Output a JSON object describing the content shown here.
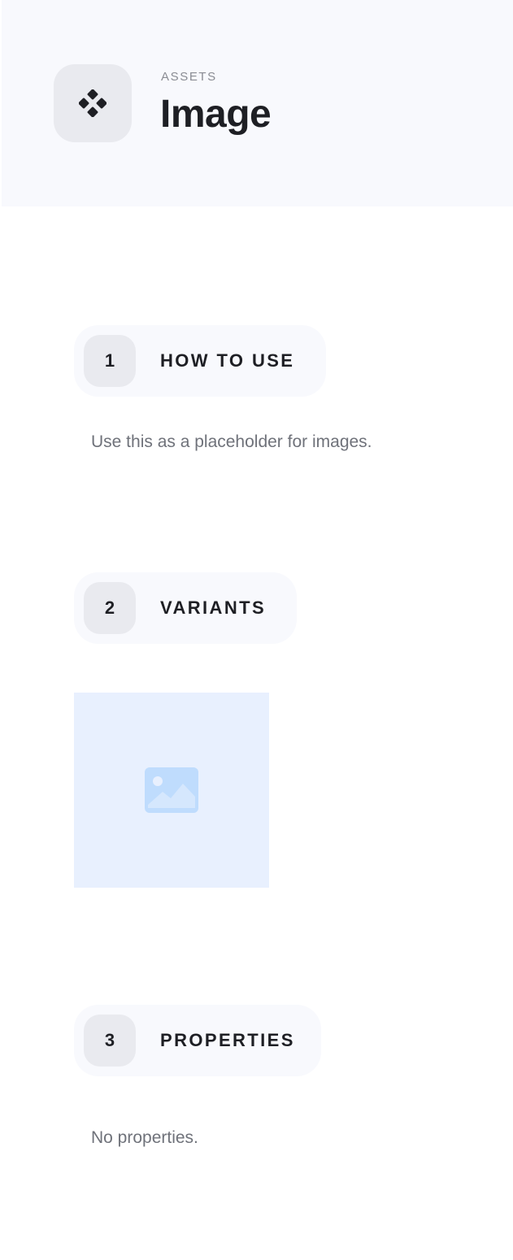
{
  "header": {
    "icon": "component-diamonds-icon",
    "overline": "ASSETS",
    "title": "Image"
  },
  "sections": [
    {
      "number": "1",
      "label": "HOW TO USE",
      "text": "Use this as a placeholder for images."
    },
    {
      "number": "2",
      "label": "VARIANTS"
    },
    {
      "number": "3",
      "label": "PROPERTIES",
      "text": "No properties."
    }
  ],
  "variants": {
    "placeholder_icon": "image-icon"
  },
  "colors": {
    "header_bg": "#f8f9fd",
    "icon_box_bg": "#e9eaef",
    "text_primary": "#1e1f24",
    "text_muted": "#6f727a",
    "placeholder_bg": "#e8f0fe",
    "placeholder_icon": "#bfdcfd"
  }
}
